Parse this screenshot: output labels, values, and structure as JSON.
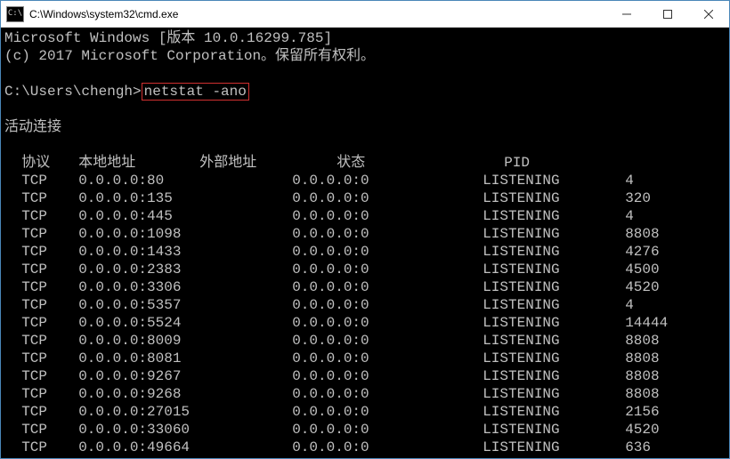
{
  "window": {
    "title": "C:\\Windows\\system32\\cmd.exe",
    "icon_glyph": "C:\\"
  },
  "terminal": {
    "banner_line1": "Microsoft Windows [版本 10.0.16299.785]",
    "banner_line2": "(c) 2017 Microsoft Corporation。保留所有权利。",
    "prompt_path": "C:\\Users\\chengh>",
    "command": "netstat -ano",
    "section_title": "活动连接",
    "headers": {
      "proto": "协议",
      "local": "本地地址",
      "foreign": "外部地址",
      "state": "状态",
      "pid": "PID"
    },
    "rows": [
      {
        "proto": "TCP",
        "local": "0.0.0.0:80",
        "foreign": "0.0.0.0:0",
        "state": "LISTENING",
        "pid": "4"
      },
      {
        "proto": "TCP",
        "local": "0.0.0.0:135",
        "foreign": "0.0.0.0:0",
        "state": "LISTENING",
        "pid": "320"
      },
      {
        "proto": "TCP",
        "local": "0.0.0.0:445",
        "foreign": "0.0.0.0:0",
        "state": "LISTENING",
        "pid": "4"
      },
      {
        "proto": "TCP",
        "local": "0.0.0.0:1098",
        "foreign": "0.0.0.0:0",
        "state": "LISTENING",
        "pid": "8808"
      },
      {
        "proto": "TCP",
        "local": "0.0.0.0:1433",
        "foreign": "0.0.0.0:0",
        "state": "LISTENING",
        "pid": "4276"
      },
      {
        "proto": "TCP",
        "local": "0.0.0.0:2383",
        "foreign": "0.0.0.0:0",
        "state": "LISTENING",
        "pid": "4500"
      },
      {
        "proto": "TCP",
        "local": "0.0.0.0:3306",
        "foreign": "0.0.0.0:0",
        "state": "LISTENING",
        "pid": "4520"
      },
      {
        "proto": "TCP",
        "local": "0.0.0.0:5357",
        "foreign": "0.0.0.0:0",
        "state": "LISTENING",
        "pid": "4"
      },
      {
        "proto": "TCP",
        "local": "0.0.0.0:5524",
        "foreign": "0.0.0.0:0",
        "state": "LISTENING",
        "pid": "14444"
      },
      {
        "proto": "TCP",
        "local": "0.0.0.0:8009",
        "foreign": "0.0.0.0:0",
        "state": "LISTENING",
        "pid": "8808"
      },
      {
        "proto": "TCP",
        "local": "0.0.0.0:8081",
        "foreign": "0.0.0.0:0",
        "state": "LISTENING",
        "pid": "8808"
      },
      {
        "proto": "TCP",
        "local": "0.0.0.0:9267",
        "foreign": "0.0.0.0:0",
        "state": "LISTENING",
        "pid": "8808"
      },
      {
        "proto": "TCP",
        "local": "0.0.0.0:9268",
        "foreign": "0.0.0.0:0",
        "state": "LISTENING",
        "pid": "8808"
      },
      {
        "proto": "TCP",
        "local": "0.0.0.0:27015",
        "foreign": "0.0.0.0:0",
        "state": "LISTENING",
        "pid": "2156"
      },
      {
        "proto": "TCP",
        "local": "0.0.0.0:33060",
        "foreign": "0.0.0.0:0",
        "state": "LISTENING",
        "pid": "4520"
      },
      {
        "proto": "TCP",
        "local": "0.0.0.0:49664",
        "foreign": "0.0.0.0:0",
        "state": "LISTENING",
        "pid": "636"
      }
    ]
  }
}
